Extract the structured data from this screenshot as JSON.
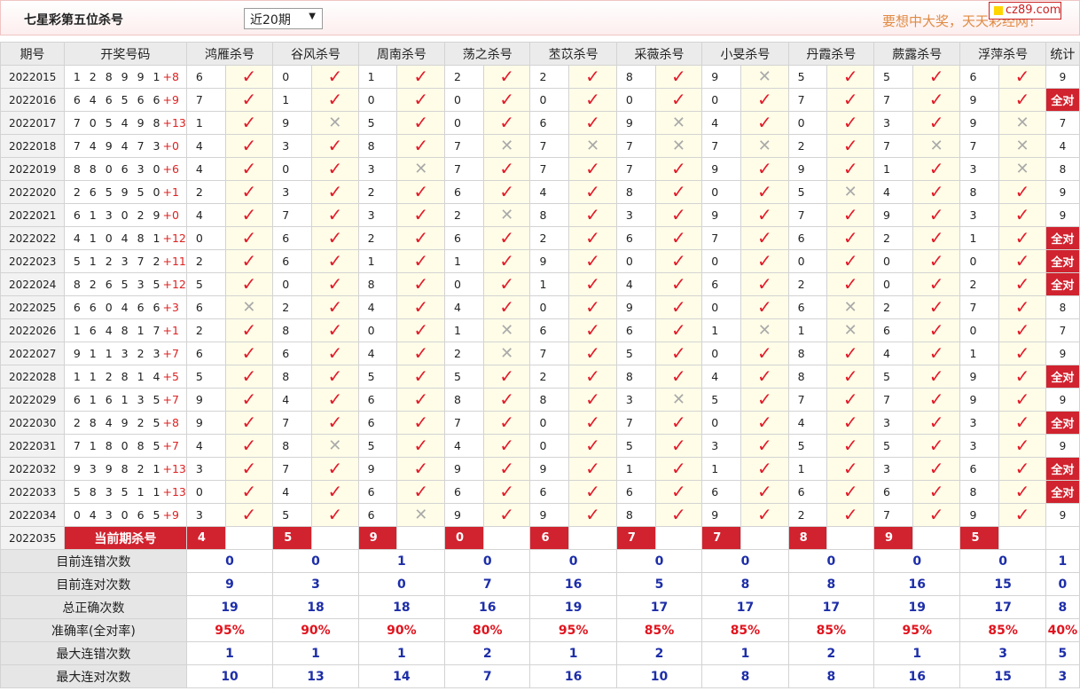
{
  "header": {
    "title": "七星彩第五位杀号",
    "select_value": "近20期",
    "promo": "要想中大奖，天天彩经网！",
    "logo": "cz89.com"
  },
  "cols": {
    "period": "期号",
    "draw": "开奖号码",
    "stat": "统计",
    "experts": [
      "鸿雁杀号",
      "谷风杀号",
      "周南杀号",
      "荡之杀号",
      "苤苡杀号",
      "采薇杀号",
      "小旻杀号",
      "丹霞杀号",
      "蕨露杀号",
      "浮萍杀号"
    ]
  },
  "rows": [
    {
      "p": "2022015",
      "d": "1 2 8 9 9 1",
      "s": "+8",
      "k": [
        "6",
        "0",
        "1",
        "2",
        "2",
        "8",
        "9",
        "5",
        "5",
        "6"
      ],
      "r": [
        1,
        1,
        1,
        1,
        1,
        1,
        0,
        1,
        1,
        1
      ],
      "t": "9"
    },
    {
      "p": "2022016",
      "d": "6 4 6 5 6 6",
      "s": "+9",
      "k": [
        "7",
        "1",
        "0",
        "0",
        "0",
        "0",
        "0",
        "7",
        "7",
        "9"
      ],
      "r": [
        1,
        1,
        1,
        1,
        1,
        1,
        1,
        1,
        1,
        1
      ],
      "t": "全对"
    },
    {
      "p": "2022017",
      "d": "7 0 5 4 9 8",
      "s": "+13",
      "k": [
        "1",
        "9",
        "5",
        "0",
        "6",
        "9",
        "4",
        "0",
        "3",
        "9"
      ],
      "r": [
        1,
        0,
        1,
        1,
        1,
        0,
        1,
        1,
        1,
        0
      ],
      "t": "7"
    },
    {
      "p": "2022018",
      "d": "7 4 9 4 7 3",
      "s": "+0",
      "k": [
        "4",
        "3",
        "8",
        "7",
        "7",
        "7",
        "7",
        "2",
        "7",
        "7"
      ],
      "r": [
        1,
        1,
        1,
        0,
        0,
        0,
        0,
        1,
        0,
        0
      ],
      "t": "4"
    },
    {
      "p": "2022019",
      "d": "8 8 0 6 3 0",
      "s": "+6",
      "k": [
        "4",
        "0",
        "3",
        "7",
        "7",
        "7",
        "9",
        "9",
        "1",
        "3"
      ],
      "r": [
        1,
        1,
        0,
        1,
        1,
        1,
        1,
        1,
        1,
        0
      ],
      "t": "8"
    },
    {
      "p": "2022020",
      "d": "2 6 5 9 5 0",
      "s": "+1",
      "k": [
        "2",
        "3",
        "2",
        "6",
        "4",
        "8",
        "0",
        "5",
        "4",
        "8"
      ],
      "r": [
        1,
        1,
        1,
        1,
        1,
        1,
        1,
        0,
        1,
        1
      ],
      "t": "9"
    },
    {
      "p": "2022021",
      "d": "6 1 3 0 2 9",
      "s": "+0",
      "k": [
        "4",
        "7",
        "3",
        "2",
        "8",
        "3",
        "9",
        "7",
        "9",
        "3"
      ],
      "r": [
        1,
        1,
        1,
        0,
        1,
        1,
        1,
        1,
        1,
        1
      ],
      "t": "9"
    },
    {
      "p": "2022022",
      "d": "4 1 0 4 8 1",
      "s": "+12",
      "k": [
        "0",
        "6",
        "2",
        "6",
        "2",
        "6",
        "7",
        "6",
        "2",
        "1"
      ],
      "r": [
        1,
        1,
        1,
        1,
        1,
        1,
        1,
        1,
        1,
        1
      ],
      "t": "全对"
    },
    {
      "p": "2022023",
      "d": "5 1 2 3 7 2",
      "s": "+11",
      "k": [
        "2",
        "6",
        "1",
        "1",
        "9",
        "0",
        "0",
        "0",
        "0",
        "0"
      ],
      "r": [
        1,
        1,
        1,
        1,
        1,
        1,
        1,
        1,
        1,
        1
      ],
      "t": "全对"
    },
    {
      "p": "2022024",
      "d": "8 2 6 5 3 5",
      "s": "+12",
      "k": [
        "5",
        "0",
        "8",
        "0",
        "1",
        "4",
        "6",
        "2",
        "0",
        "2"
      ],
      "r": [
        1,
        1,
        1,
        1,
        1,
        1,
        1,
        1,
        1,
        1
      ],
      "t": "全对"
    },
    {
      "p": "2022025",
      "d": "6 6 0 4 6 6",
      "s": "+3",
      "k": [
        "6",
        "2",
        "4",
        "4",
        "0",
        "9",
        "0",
        "6",
        "2",
        "7"
      ],
      "r": [
        0,
        1,
        1,
        1,
        1,
        1,
        1,
        0,
        1,
        1
      ],
      "t": "8"
    },
    {
      "p": "2022026",
      "d": "1 6 4 8 1 7",
      "s": "+1",
      "k": [
        "2",
        "8",
        "0",
        "1",
        "6",
        "6",
        "1",
        "1",
        "6",
        "0"
      ],
      "r": [
        1,
        1,
        1,
        0,
        1,
        1,
        0,
        0,
        1,
        1
      ],
      "t": "7"
    },
    {
      "p": "2022027",
      "d": "9 1 1 3 2 3",
      "s": "+7",
      "k": [
        "6",
        "6",
        "4",
        "2",
        "7",
        "5",
        "0",
        "8",
        "4",
        "1"
      ],
      "r": [
        1,
        1,
        1,
        0,
        1,
        1,
        1,
        1,
        1,
        1
      ],
      "t": "9"
    },
    {
      "p": "2022028",
      "d": "1 1 2 8 1 4",
      "s": "+5",
      "k": [
        "5",
        "8",
        "5",
        "5",
        "2",
        "8",
        "4",
        "8",
        "5",
        "9"
      ],
      "r": [
        1,
        1,
        1,
        1,
        1,
        1,
        1,
        1,
        1,
        1
      ],
      "t": "全对"
    },
    {
      "p": "2022029",
      "d": "6 1 6 1 3 5",
      "s": "+7",
      "k": [
        "9",
        "4",
        "6",
        "8",
        "8",
        "3",
        "5",
        "7",
        "7",
        "9"
      ],
      "r": [
        1,
        1,
        1,
        1,
        1,
        0,
        1,
        1,
        1,
        1
      ],
      "t": "9"
    },
    {
      "p": "2022030",
      "d": "2 8 4 9 2 5",
      "s": "+8",
      "k": [
        "9",
        "7",
        "6",
        "7",
        "0",
        "7",
        "0",
        "4",
        "3",
        "3"
      ],
      "r": [
        1,
        1,
        1,
        1,
        1,
        1,
        1,
        1,
        1,
        1
      ],
      "t": "全对"
    },
    {
      "p": "2022031",
      "d": "7 1 8 0 8 5",
      "s": "+7",
      "k": [
        "4",
        "8",
        "5",
        "4",
        "0",
        "5",
        "3",
        "5",
        "5",
        "3"
      ],
      "r": [
        1,
        0,
        1,
        1,
        1,
        1,
        1,
        1,
        1,
        1
      ],
      "t": "9"
    },
    {
      "p": "2022032",
      "d": "9 3 9 8 2 1",
      "s": "+13",
      "k": [
        "3",
        "7",
        "9",
        "9",
        "9",
        "1",
        "1",
        "1",
        "3",
        "6"
      ],
      "r": [
        1,
        1,
        1,
        1,
        1,
        1,
        1,
        1,
        1,
        1
      ],
      "t": "全对"
    },
    {
      "p": "2022033",
      "d": "5 8 3 5 1 1",
      "s": "+13",
      "k": [
        "0",
        "4",
        "6",
        "6",
        "6",
        "6",
        "6",
        "6",
        "6",
        "8"
      ],
      "r": [
        1,
        1,
        1,
        1,
        1,
        1,
        1,
        1,
        1,
        1
      ],
      "t": "全对"
    },
    {
      "p": "2022034",
      "d": "0 4 3 0 6 5",
      "s": "+9",
      "k": [
        "3",
        "5",
        "6",
        "9",
        "9",
        "8",
        "9",
        "2",
        "7",
        "9"
      ],
      "r": [
        1,
        1,
        0,
        1,
        1,
        1,
        1,
        1,
        1,
        1
      ],
      "t": "9"
    }
  ],
  "current": {
    "p": "2022035",
    "label": "当前期杀号",
    "k": [
      "4",
      "5",
      "9",
      "0",
      "6",
      "7",
      "7",
      "8",
      "9",
      "5"
    ]
  },
  "summary": [
    {
      "label": "目前连错次数",
      "v": [
        "0",
        "0",
        "1",
        "0",
        "0",
        "0",
        "0",
        "0",
        "0",
        "0"
      ],
      "t": "1",
      "color": "blue"
    },
    {
      "label": "目前连对次数",
      "v": [
        "9",
        "3",
        "0",
        "7",
        "16",
        "5",
        "8",
        "8",
        "16",
        "15"
      ],
      "t": "0",
      "color": "blue"
    },
    {
      "label": "总正确次数",
      "v": [
        "19",
        "18",
        "18",
        "16",
        "19",
        "17",
        "17",
        "17",
        "19",
        "17"
      ],
      "t": "8",
      "color": "blue"
    },
    {
      "label": "准确率(全对率)",
      "v": [
        "95%",
        "90%",
        "90%",
        "80%",
        "95%",
        "85%",
        "85%",
        "85%",
        "95%",
        "85%"
      ],
      "t": "40%",
      "color": "red"
    },
    {
      "label": "最大连错次数",
      "v": [
        "1",
        "1",
        "1",
        "2",
        "1",
        "2",
        "1",
        "2",
        "1",
        "3"
      ],
      "t": "5",
      "color": "blue"
    },
    {
      "label": "最大连对次数",
      "v": [
        "10",
        "13",
        "14",
        "7",
        "16",
        "10",
        "8",
        "8",
        "16",
        "15"
      ],
      "t": "3",
      "color": "blue"
    }
  ],
  "icons": {
    "right": "check-mark-icon",
    "wrong": "cross-mark-icon"
  },
  "colors": {
    "accent": "#d0232f",
    "blue": "#1d2ea8",
    "red": "#e0141e"
  }
}
